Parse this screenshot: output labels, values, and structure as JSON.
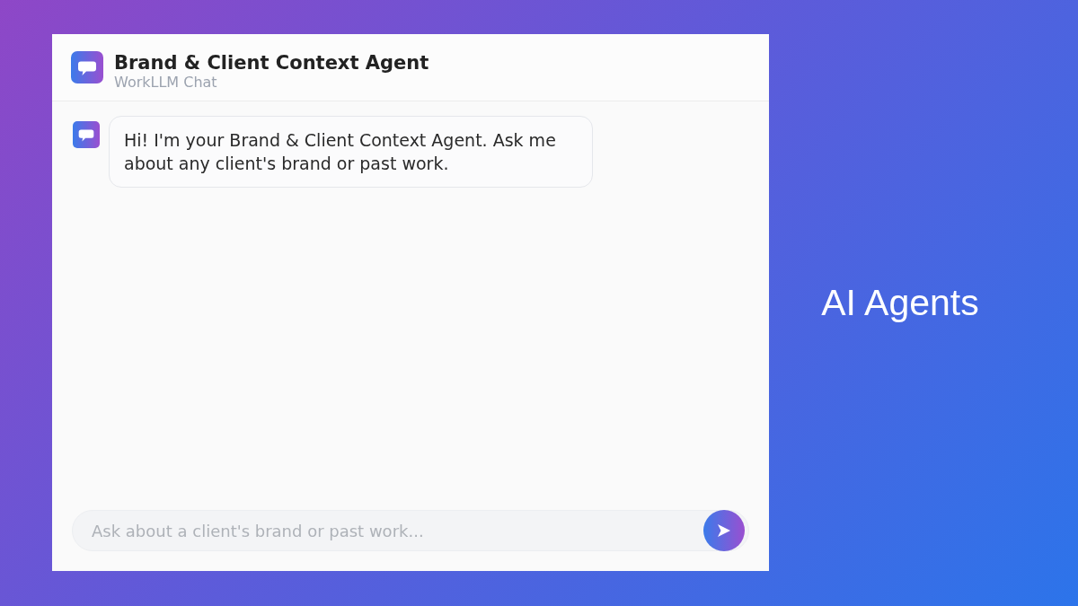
{
  "chat": {
    "header": {
      "title": "Brand & Client Context Agent",
      "subtitle": "WorkLLM Chat"
    },
    "messages": [
      {
        "kind": "agent",
        "text": "Hi! I'm your Brand & Client Context Agent. Ask me about any client's brand or past work."
      }
    ],
    "composer": {
      "placeholder": "Ask about a client's brand or past work..."
    }
  },
  "caption": "AI Agents"
}
